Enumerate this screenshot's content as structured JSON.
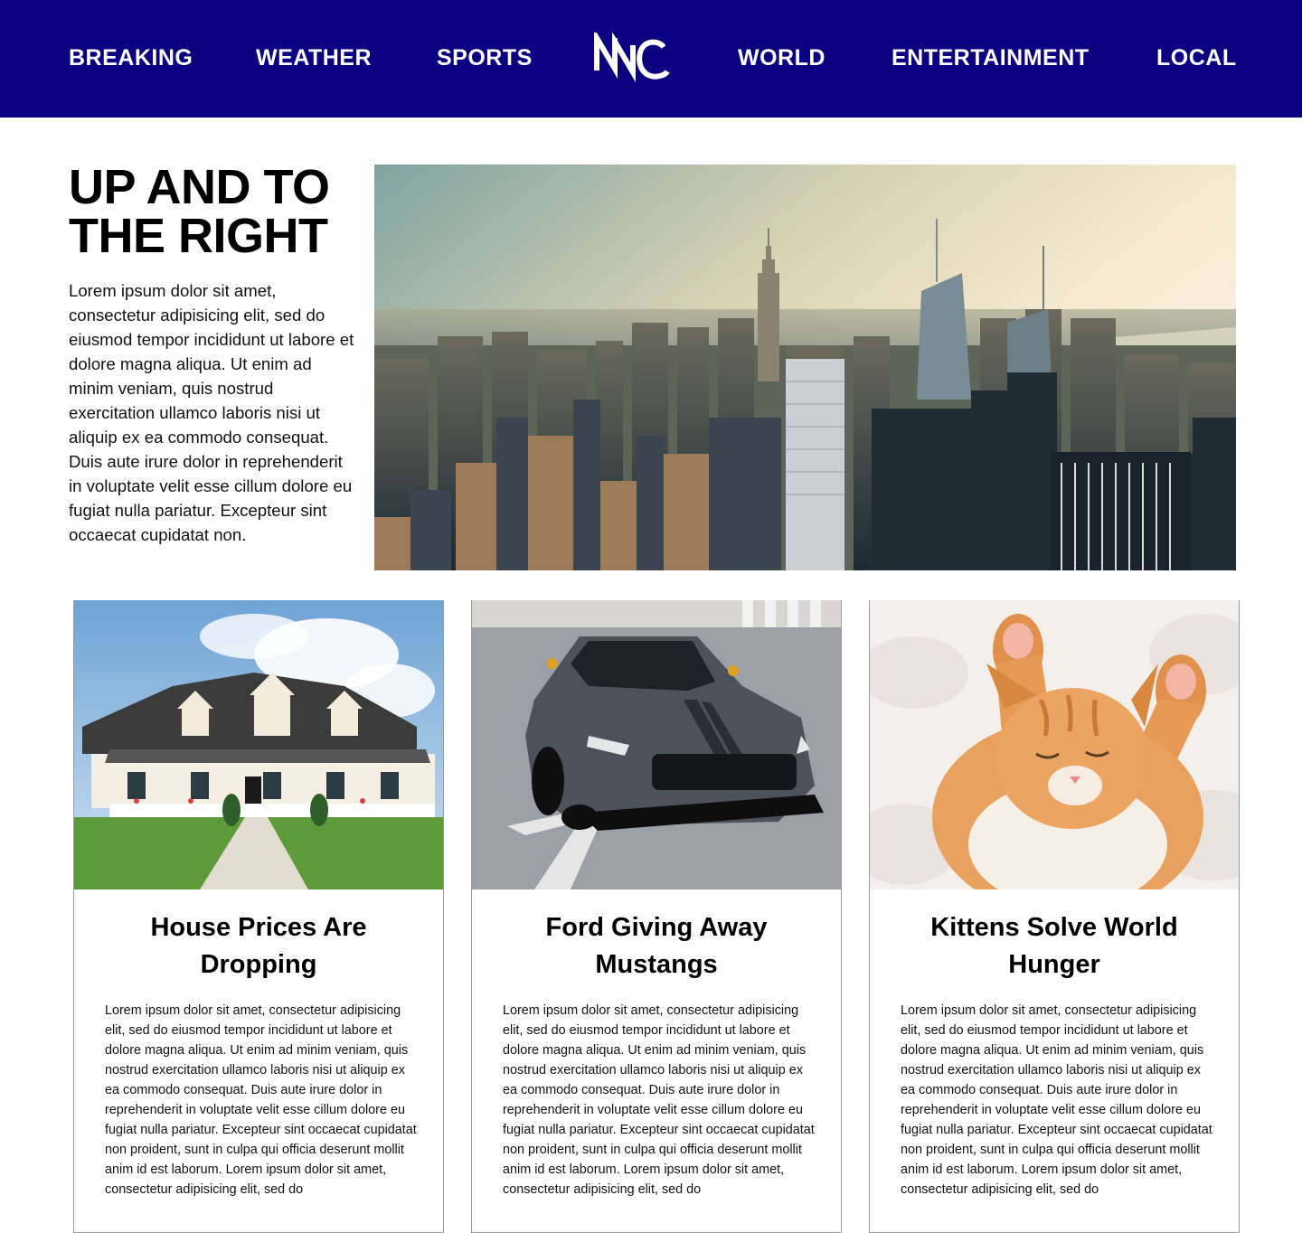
{
  "nav": {
    "items": [
      {
        "label": "BREAKING"
      },
      {
        "label": "WEATHER"
      },
      {
        "label": "SPORTS"
      },
      {
        "label": "WORLD"
      },
      {
        "label": "ENTERTAINMENT"
      },
      {
        "label": "LOCAL"
      }
    ],
    "logo_text": "NNC",
    "logo_icon": "nnc-logo-icon"
  },
  "hero": {
    "title": "UP AND TO THE RIGHT",
    "body": "Lorem ipsum dolor sit amet, consectetur adipisicing elit, sed do eiusmod tempor incididunt ut labore et dolore magna aliqua. Ut enim ad minim veniam, quis nostrud exercitation ullamco laboris nisi ut aliquip ex ea commodo consequat. Duis aute irure dolor in reprehenderit in voluptate velit esse cillum dolore eu fugiat nulla pariatur. Excepteur sint occaecat cupidatat non.",
    "image": "city-skyline-image"
  },
  "cards": [
    {
      "title": "House Prices Are Dropping",
      "image": "house-image",
      "body": "Lorem ipsum dolor sit amet, consectetur adipisicing elit, sed do eiusmod tempor incididunt ut labore et dolore magna aliqua. Ut enim ad minim veniam, quis nostrud exercitation ullamco laboris nisi ut aliquip ex ea commodo consequat. Duis aute irure dolor in reprehenderit in voluptate velit esse cillum dolore eu fugiat nulla pariatur. Excepteur sint occaecat cupidatat non proident, sunt in culpa qui officia deserunt mollit anim id est laborum. Lorem ipsum dolor sit amet, consectetur adipisicing elit, sed do"
    },
    {
      "title": "Ford Giving Away Mustangs",
      "image": "mustang-car-image",
      "body": "Lorem ipsum dolor sit amet, consectetur adipisicing elit, sed do eiusmod tempor incididunt ut labore et dolore magna aliqua. Ut enim ad minim veniam, quis nostrud exercitation ullamco laboris nisi ut aliquip ex ea commodo consequat. Duis aute irure dolor in reprehenderit in voluptate velit esse cillum dolore eu fugiat nulla pariatur. Excepteur sint occaecat cupidatat non proident, sunt in culpa qui officia deserunt mollit anim id est laborum. Lorem ipsum dolor sit amet, consectetur adipisicing elit, sed do"
    },
    {
      "title": "Kittens Solve World Hunger",
      "image": "kitten-image",
      "body": "Lorem ipsum dolor sit amet, consectetur adipisicing elit, sed do eiusmod tempor incididunt ut labore et dolore magna aliqua. Ut enim ad minim veniam, quis nostrud exercitation ullamco laboris nisi ut aliquip ex ea commodo consequat. Duis aute irure dolor in reprehenderit in voluptate velit esse cillum dolore eu fugiat nulla pariatur. Excepteur sint occaecat cupidatat non proident, sunt in culpa qui officia deserunt mollit anim id est laborum. Lorem ipsum dolor sit amet, consectetur adipisicing elit, sed do"
    }
  ],
  "colors": {
    "nav_background": "#0a0080",
    "nav_text": "#ffffff",
    "card_border": "#9a9a9a"
  }
}
